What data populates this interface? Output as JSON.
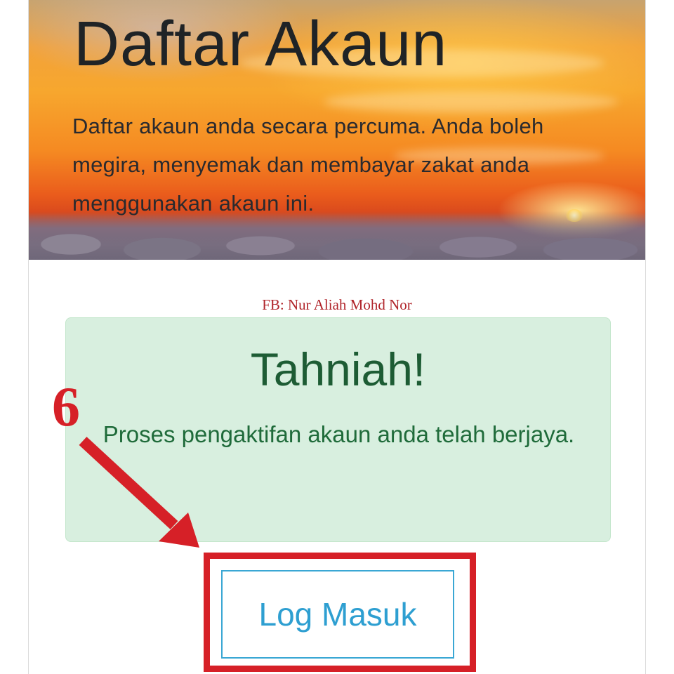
{
  "hero": {
    "title": "Daftar Akaun",
    "description": "Daftar akaun anda secara percuma. Anda boleh megira, menyemak dan membayar zakat anda menggunakan akaun ini."
  },
  "credit": "FB: Nur Aliah Mohd Nor",
  "alert": {
    "title": "Tahniah!",
    "message": "Proses pengaktifan akaun anda telah berjaya."
  },
  "login_button": {
    "label": "Log Masuk"
  },
  "annotation": {
    "step_number": "6",
    "color": "#d62027"
  },
  "colors": {
    "alert_background": "#d8efdf",
    "alert_text": "#1d5c34",
    "button_accent": "#2e9fd1"
  },
  "icons": {
    "annotation_arrow": "arrow-down-right-icon"
  }
}
